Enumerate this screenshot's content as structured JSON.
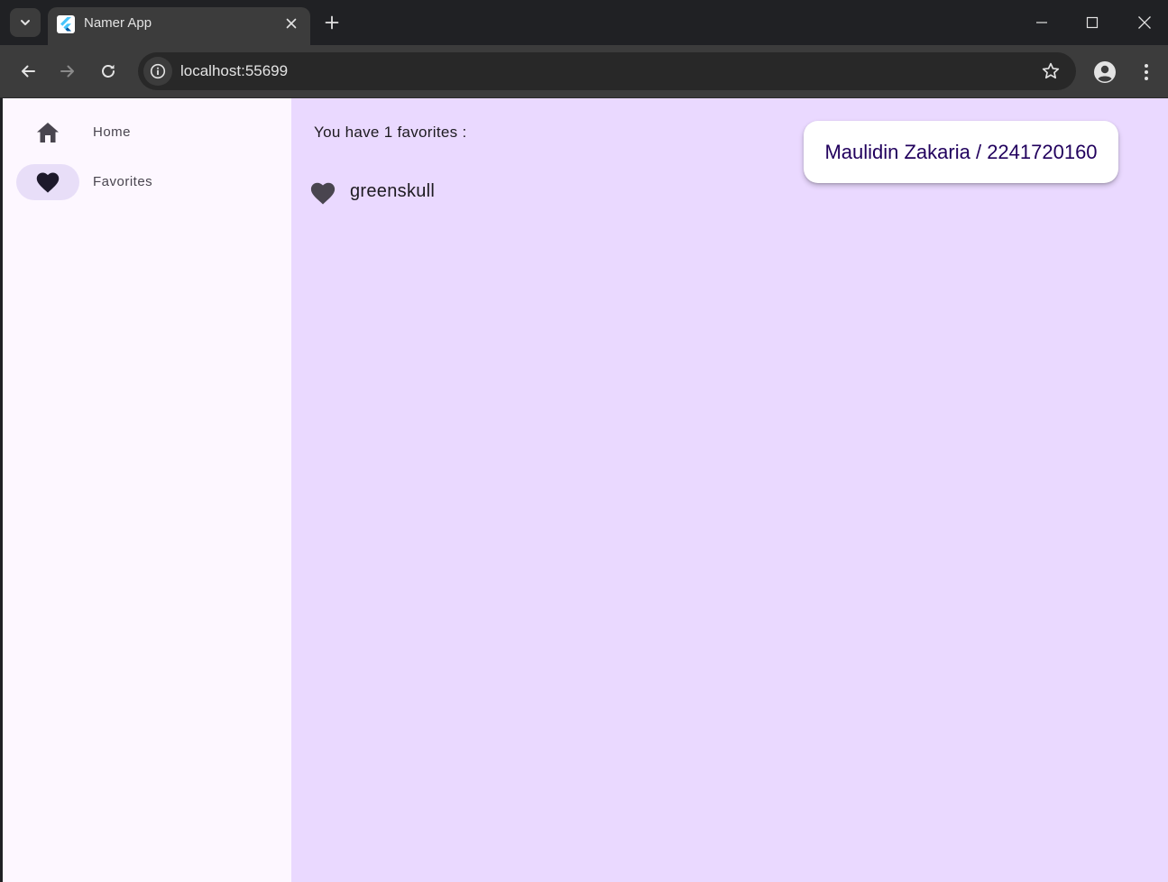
{
  "browser": {
    "tab": {
      "title": "Namer App",
      "favicon": "flutter-logo-icon"
    },
    "address_bar": {
      "url": "localhost:55699"
    },
    "icons": {
      "tab_list": "chevron-down-icon",
      "close_tab": "close-icon",
      "new_tab": "plus-icon",
      "minimize": "minimize-icon",
      "maximize": "maximize-icon",
      "close_window": "close-icon",
      "back": "arrow-left-icon",
      "forward": "arrow-right-icon",
      "reload": "reload-icon",
      "site_info": "info-icon",
      "bookmark": "star-icon",
      "profile": "account-icon",
      "menu": "more-vert-icon"
    }
  },
  "app": {
    "navigation": {
      "items": [
        {
          "label": "Home",
          "icon": "home-icon",
          "selected": false
        },
        {
          "label": "Favorites",
          "icon": "heart-icon",
          "selected": true
        }
      ]
    },
    "favorites_page": {
      "count_text": "You have 1 favorites :",
      "items": [
        {
          "label": "greenskull",
          "icon": "heart-icon"
        }
      ]
    },
    "name_card": {
      "text": "Maulidin Zakaria / 2241720160"
    }
  },
  "colors": {
    "rail_background": "#fdf7ff",
    "content_background": "#ead9ff",
    "selected_indicator": "#e8def8",
    "card_text": "#21005d",
    "icon_color": "#49454f"
  }
}
